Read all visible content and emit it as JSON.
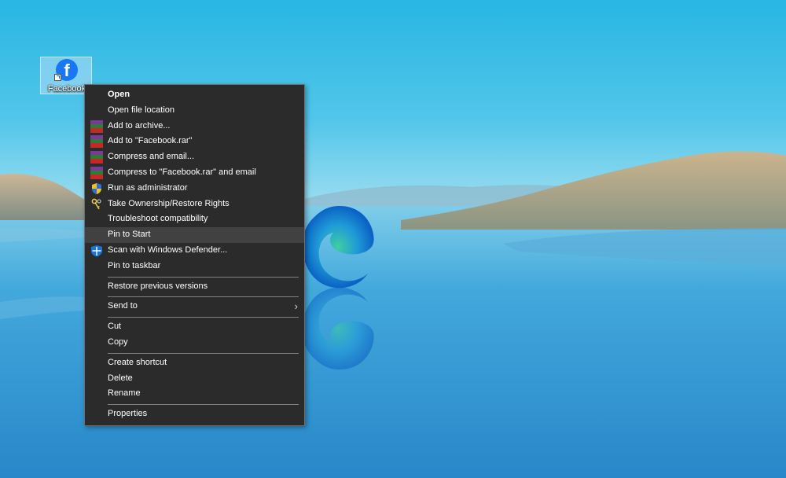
{
  "desktop": {
    "icon_label": "Facebook",
    "icon_glyph": "f"
  },
  "context_menu": {
    "items": [
      {
        "label": "Open"
      },
      {
        "label": "Open file location"
      },
      {
        "label": "Add to archive...",
        "icon": "winrar-icon"
      },
      {
        "label": "Add to \"Facebook.rar\"",
        "icon": "winrar-icon"
      },
      {
        "label": "Compress and email...",
        "icon": "winrar-icon"
      },
      {
        "label": "Compress to \"Facebook.rar\" and email",
        "icon": "winrar-icon"
      },
      {
        "label": "Run as administrator",
        "icon": "uac-shield-icon"
      },
      {
        "label": "Take Ownership/Restore Rights",
        "icon": "keys-icon"
      },
      {
        "label": "Troubleshoot compatibility"
      },
      {
        "label": "Pin to Start"
      },
      {
        "label": "Scan with Windows Defender...",
        "icon": "defender-shield-icon"
      },
      {
        "label": "Pin to taskbar"
      },
      {
        "label": "Restore previous versions"
      },
      {
        "label": "Send to"
      },
      {
        "label": "Cut"
      },
      {
        "label": "Copy"
      },
      {
        "label": "Create shortcut"
      },
      {
        "label": "Delete"
      },
      {
        "label": "Rename"
      },
      {
        "label": "Properties"
      }
    ],
    "submenu_arrow": "›"
  },
  "colors": {
    "menu_bg": "#2b2b2b",
    "menu_highlight": "#414141",
    "facebook_blue": "#1877f2"
  }
}
